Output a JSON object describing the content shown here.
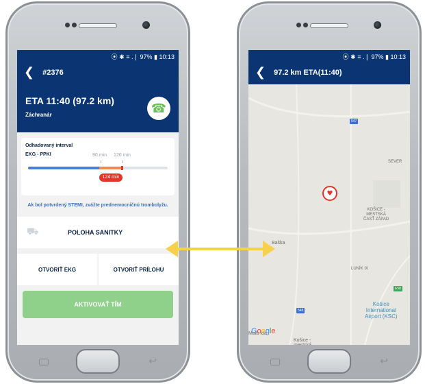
{
  "colors": {
    "header_blue": "#0a3472",
    "accent_blue": "#3a6fc4",
    "activate_green": "#8fd18b",
    "alert_red": "#e2362b",
    "arrow_yellow": "#f7d04c"
  },
  "left_phone": {
    "status_bar": "⦿ ✱ ≡ .❘ 97% ▮ 10:13",
    "app_bar": {
      "back_icon": "❮",
      "title": "#2376"
    },
    "eta": {
      "title": "ETA 11:40 (97.2 km)",
      "role": "Záchranár",
      "call_icon": "☎"
    },
    "interval": {
      "label": "Odhadovaný interval",
      "type": "EKG - PPKI",
      "tick_90": "90 min",
      "tick_120": "120 min",
      "current": "124 min"
    },
    "stemi_note": "Ak bol potvrdený STEMI, zvážte prednemocničnú trombolyžu.",
    "ambulance_row": {
      "icon": "⛟",
      "label": "POLOHA SANITKY"
    },
    "buttons": {
      "open_ekg": "OTVORIŤ EKG",
      "open_attachment": "OTVORIŤ PRÍLOHU"
    },
    "activate": "AKTIVOVAŤ TÍM",
    "nav_back": "↩"
  },
  "right_phone": {
    "status_bar": "⦿ ✱ ≡ .❘ 97% ▮ 10:13",
    "app_bar": {
      "back_icon": "❮",
      "title": "97.2 km ETA(11:40)"
    },
    "map": {
      "shields": {
        "a": "547",
        "b": "548",
        "c": "E58"
      },
      "labels": {
        "sever": "SEVER",
        "kosice_zapad": "KOŠICE -\nMESTSKÁ\nČASŤ ZÁPAD",
        "baska": "Baška",
        "lunik": "LUNÍK IX",
        "mala_ida": "Malá Ida",
        "kosice_mestska": "Košice -\nmestská"
      },
      "airport": "Košice\nInternational\nAirport (KSC)",
      "marker_icon": "♥",
      "google": [
        "G",
        "o",
        "o",
        "g",
        "l",
        "e"
      ]
    },
    "nav_back": "↩"
  }
}
